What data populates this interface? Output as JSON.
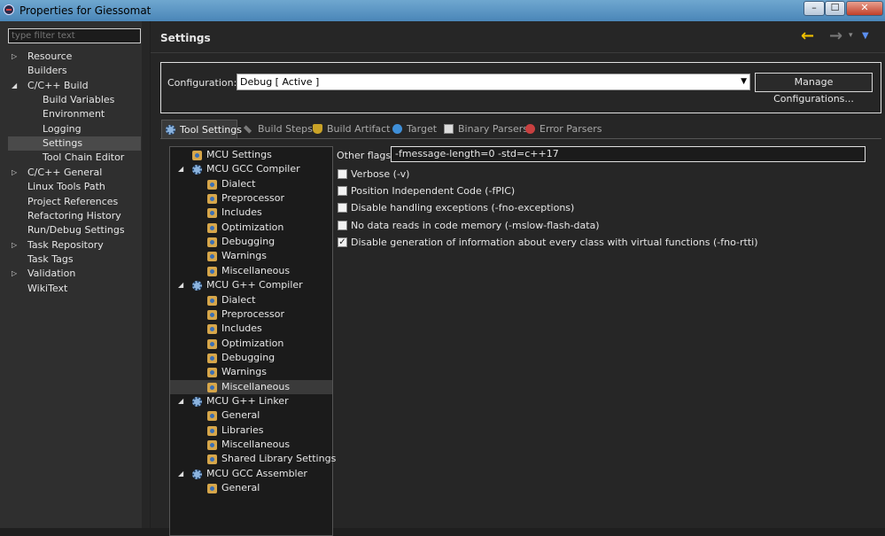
{
  "window": {
    "title": "Properties for Giessomat",
    "buttons": [
      "–",
      "☐",
      "✕"
    ]
  },
  "sidebar": {
    "filter_placeholder": "type filter text",
    "items": [
      {
        "label": "Resource",
        "expand": "▷",
        "indent": 0
      },
      {
        "label": "Builders",
        "expand": "",
        "indent": 0
      },
      {
        "label": "C/C++ Build",
        "expand": "◢",
        "indent": 0
      },
      {
        "label": "Build Variables",
        "expand": "",
        "indent": 1
      },
      {
        "label": "Environment",
        "expand": "",
        "indent": 1
      },
      {
        "label": "Logging",
        "expand": "",
        "indent": 1
      },
      {
        "label": "Settings",
        "expand": "",
        "indent": 1,
        "selected": true
      },
      {
        "label": "Tool Chain Editor",
        "expand": "",
        "indent": 1
      },
      {
        "label": "C/C++ General",
        "expand": "▷",
        "indent": 0
      },
      {
        "label": "Linux Tools Path",
        "expand": "",
        "indent": 0
      },
      {
        "label": "Project References",
        "expand": "",
        "indent": 0
      },
      {
        "label": "Refactoring History",
        "expand": "",
        "indent": 0
      },
      {
        "label": "Run/Debug Settings",
        "expand": "",
        "indent": 0
      },
      {
        "label": "Task Repository",
        "expand": "▷",
        "indent": 0
      },
      {
        "label": "Task Tags",
        "expand": "",
        "indent": 0
      },
      {
        "label": "Validation",
        "expand": "▷",
        "indent": 0
      },
      {
        "label": "WikiText",
        "expand": "",
        "indent": 0
      }
    ]
  },
  "header": {
    "title": "Settings",
    "back_icon": "←",
    "forward_icon": "→",
    "dropdown_icon": "▾",
    "view_menu_icon": "▼"
  },
  "configuration": {
    "label": "Configuration:",
    "selected": "Debug  [ Active ]",
    "dropdown_icon": "▼",
    "manage_label": "Manage Configurations..."
  },
  "tabs": [
    {
      "label": "Tool Settings",
      "icon": "tool-settings-icon",
      "active": true
    },
    {
      "label": "Build Steps",
      "icon": "build-steps-icon"
    },
    {
      "label": "Build Artifact",
      "icon": "build-artifact-icon"
    },
    {
      "label": "Target",
      "icon": "target-icon"
    },
    {
      "label": "Binary Parsers",
      "icon": "binary-parsers-icon"
    },
    {
      "label": "Error Parsers",
      "icon": "error-parsers-icon"
    }
  ],
  "tool_tree": [
    {
      "label": "MCU Settings",
      "level": 1,
      "icon": "folder-gear-icon",
      "expand": ""
    },
    {
      "label": "MCU GCC Compiler",
      "level": 0,
      "icon": "gear-icon",
      "expand": "◢"
    },
    {
      "label": "Dialect",
      "level": 2,
      "icon": "folder-gear-icon",
      "expand": ""
    },
    {
      "label": "Preprocessor",
      "level": 2,
      "icon": "folder-gear-icon",
      "expand": ""
    },
    {
      "label": "Includes",
      "level": 2,
      "icon": "folder-gear-icon",
      "expand": ""
    },
    {
      "label": "Optimization",
      "level": 2,
      "icon": "folder-gear-icon",
      "expand": ""
    },
    {
      "label": "Debugging",
      "level": 2,
      "icon": "folder-gear-icon",
      "expand": ""
    },
    {
      "label": "Warnings",
      "level": 2,
      "icon": "folder-gear-icon",
      "expand": ""
    },
    {
      "label": "Miscellaneous",
      "level": 2,
      "icon": "folder-gear-icon",
      "expand": ""
    },
    {
      "label": "MCU G++ Compiler",
      "level": 0,
      "icon": "gear-icon",
      "expand": "◢"
    },
    {
      "label": "Dialect",
      "level": 2,
      "icon": "folder-gear-icon",
      "expand": ""
    },
    {
      "label": "Preprocessor",
      "level": 2,
      "icon": "folder-gear-icon",
      "expand": ""
    },
    {
      "label": "Includes",
      "level": 2,
      "icon": "folder-gear-icon",
      "expand": ""
    },
    {
      "label": "Optimization",
      "level": 2,
      "icon": "folder-gear-icon",
      "expand": ""
    },
    {
      "label": "Debugging",
      "level": 2,
      "icon": "folder-gear-icon",
      "expand": ""
    },
    {
      "label": "Warnings",
      "level": 2,
      "icon": "folder-gear-icon",
      "expand": ""
    },
    {
      "label": "Miscellaneous",
      "level": 2,
      "icon": "folder-gear-icon",
      "expand": "",
      "selected": true
    },
    {
      "label": "MCU G++ Linker",
      "level": 0,
      "icon": "gear-icon",
      "expand": "◢"
    },
    {
      "label": "General",
      "level": 2,
      "icon": "folder-gear-icon",
      "expand": ""
    },
    {
      "label": "Libraries",
      "level": 2,
      "icon": "folder-gear-icon",
      "expand": ""
    },
    {
      "label": "Miscellaneous",
      "level": 2,
      "icon": "folder-gear-icon",
      "expand": ""
    },
    {
      "label": "Shared Library Settings",
      "level": 2,
      "icon": "folder-gear-icon",
      "expand": ""
    },
    {
      "label": "MCU GCC Assembler",
      "level": 0,
      "icon": "gear-icon",
      "expand": "◢"
    },
    {
      "label": "General",
      "level": 2,
      "icon": "folder-gear-icon",
      "expand": ""
    }
  ],
  "misc_panel": {
    "other_flags_label": "Other flags",
    "other_flags_value": "-fmessage-length=0 -std=c++17",
    "checkmark": "✓",
    "checkboxes": [
      {
        "label": "Verbose (-v)",
        "checked": false
      },
      {
        "label": "Position Independent Code (-fPIC)",
        "checked": false
      },
      {
        "label": "Disable handling exceptions (-fno-exceptions)",
        "checked": false
      },
      {
        "label": "No data reads in code memory (-mslow-flash-data)",
        "checked": false
      },
      {
        "label": "Disable generation of information about every class with virtual functions (-fno-rtti)",
        "checked": true
      }
    ]
  }
}
